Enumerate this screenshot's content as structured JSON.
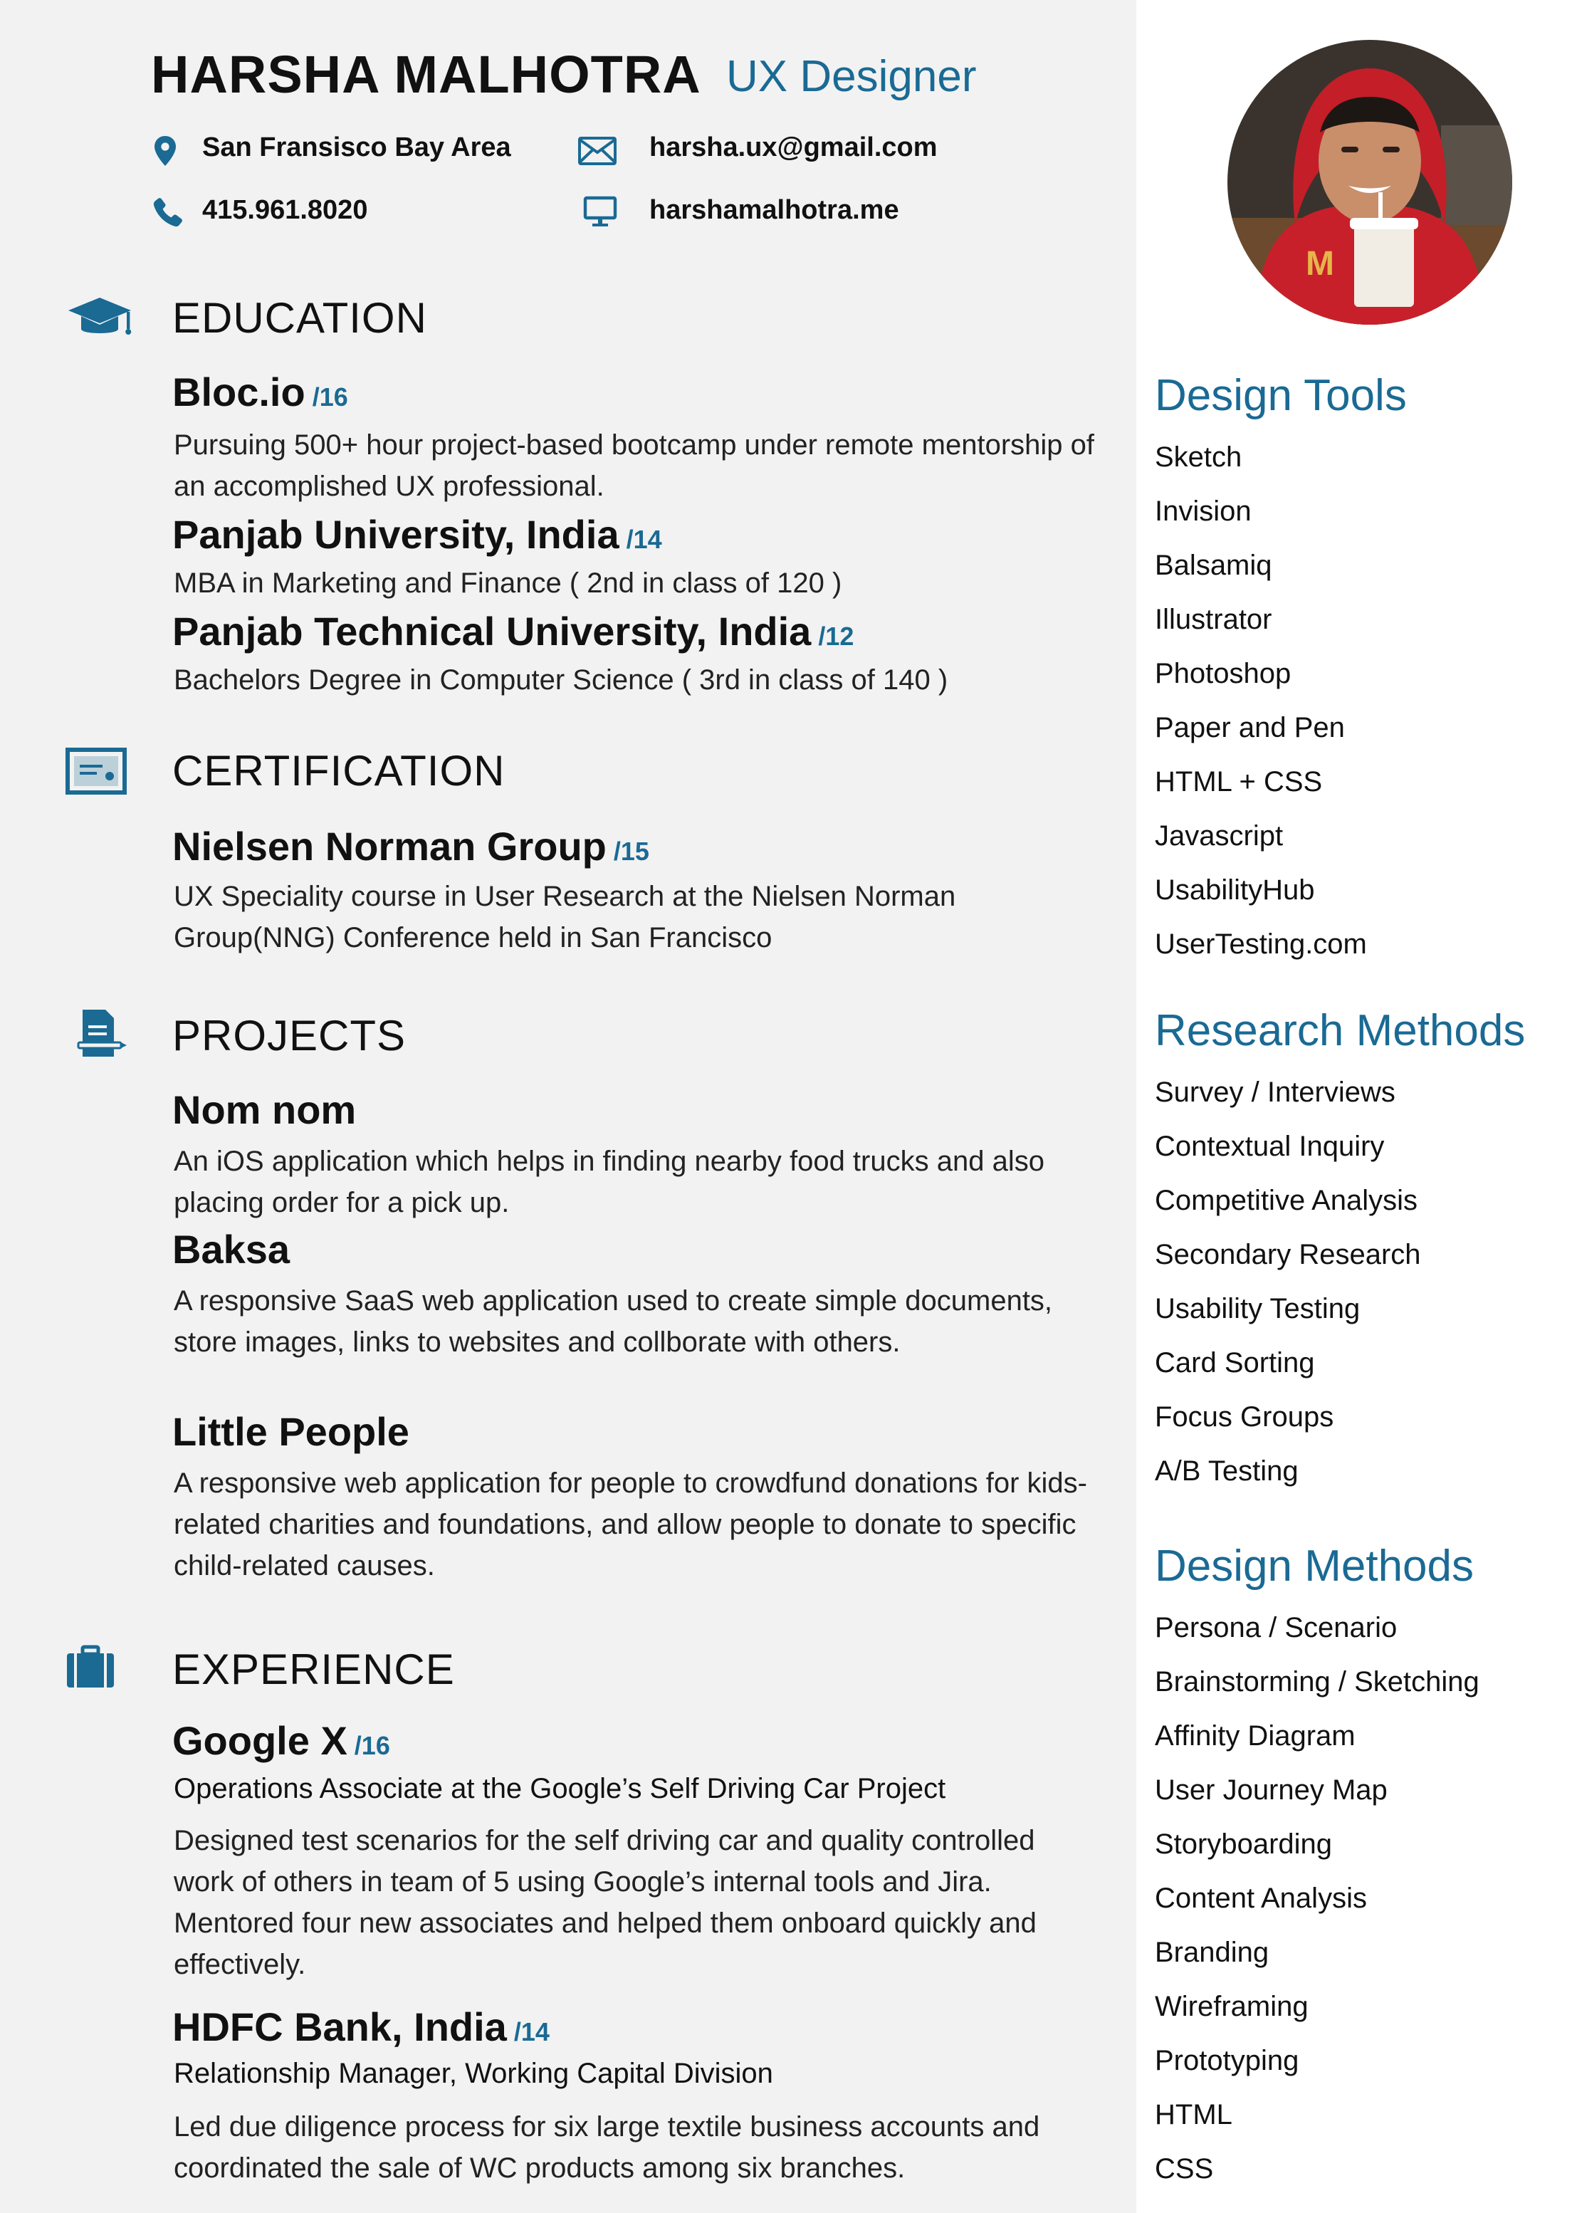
{
  "header": {
    "name": "HARSHA MALHOTRA",
    "role": "UX Designer",
    "location": "San Fransisco Bay Area",
    "email": "harsha.ux@gmail.com",
    "phone": "415.961.8020",
    "website": "harshamalhotra.me"
  },
  "colors": {
    "accent": "#1a6a94",
    "sidebar_bg": "#ffffff",
    "page_bg": "#f2f2f2"
  },
  "icons": {
    "location": "map-pin-icon",
    "email": "envelope-icon",
    "phone": "phone-icon",
    "website": "monitor-icon",
    "education": "graduation-cap-icon",
    "certification": "certificate-icon",
    "projects": "document-pen-icon",
    "experience": "briefcase-icon"
  },
  "education": {
    "title": "EDUCATION",
    "items": [
      {
        "name": "Bloc.io",
        "year": "/16",
        "desc": "Pursuing 500+ hour project-based bootcamp under remote mentorship of an accomplished UX professional."
      },
      {
        "name": "Panjab University, India",
        "year": "/14",
        "desc": "MBA in Marketing and Finance ( 2nd in class of 120 )"
      },
      {
        "name": "Panjab Technical University, India",
        "year": "/12",
        "desc": "Bachelors Degree in Computer Science ( 3rd in class of 140 )"
      }
    ]
  },
  "certification": {
    "title": "CERTIFICATION",
    "items": [
      {
        "name": "Nielsen  Norman Group",
        "year": "/15",
        "desc": "UX Speciality course in User Research at the Nielsen Norman Group(NNG) Conference held in San Francisco"
      }
    ]
  },
  "projects": {
    "title": "PROJECTS",
    "items": [
      {
        "name": "Nom nom",
        "desc": "An iOS application which helps in finding nearby food trucks and also placing order for a pick up."
      },
      {
        "name": "Baksa",
        "desc": "A responsive SaaS web application used to create simple documents, store images, links to websites and collborate with others."
      },
      {
        "name": "Little People",
        "desc": "A responsive web application for people to crowdfund donations for kids-related charities and foundations, and allow people to donate to specific child-related causes."
      }
    ]
  },
  "experience": {
    "title": "EXPERIENCE",
    "items": [
      {
        "name": "Google X",
        "year": "/16",
        "role": "Operations Associate at the Google’s Self Driving Car Project",
        "desc": "Designed test scenarios for the self driving car and quality controlled work of others in team of 5 using Google’s internal tools and Jira. Mentored four new associates and helped them onboard quickly and effectively."
      },
      {
        "name": "HDFC Bank, India",
        "year": "/14",
        "role": "Relationship Manager, Working Capital Division",
        "desc": "Led due diligence process for six large textile business accounts and coordinated the sale of WC products among six branches."
      }
    ]
  },
  "sidebar": {
    "design_tools": {
      "title": "Design Tools",
      "items": [
        "Sketch",
        "Invision",
        "Balsamiq",
        "Illustrator",
        "Photoshop",
        "Paper and Pen",
        "HTML + CSS",
        "Javascript",
        "UsabilityHub",
        "UserTesting.com"
      ]
    },
    "research_methods": {
      "title": "Research Methods",
      "items": [
        "Survey / Interviews",
        "Contextual Inquiry",
        "Competitive Analysis",
        "Secondary Research",
        "Usability Testing",
        "Card Sorting",
        "Focus Groups",
        "A/B Testing"
      ]
    },
    "design_methods": {
      "title": "Design Methods",
      "items": [
        "Persona / Scenario",
        "Brainstorming / Sketching",
        "Affinity Diagram",
        "User Journey Map",
        "Storyboarding",
        "Content Analysis",
        "Branding",
        "Wireframing",
        "Prototyping",
        "HTML",
        "CSS"
      ]
    }
  }
}
